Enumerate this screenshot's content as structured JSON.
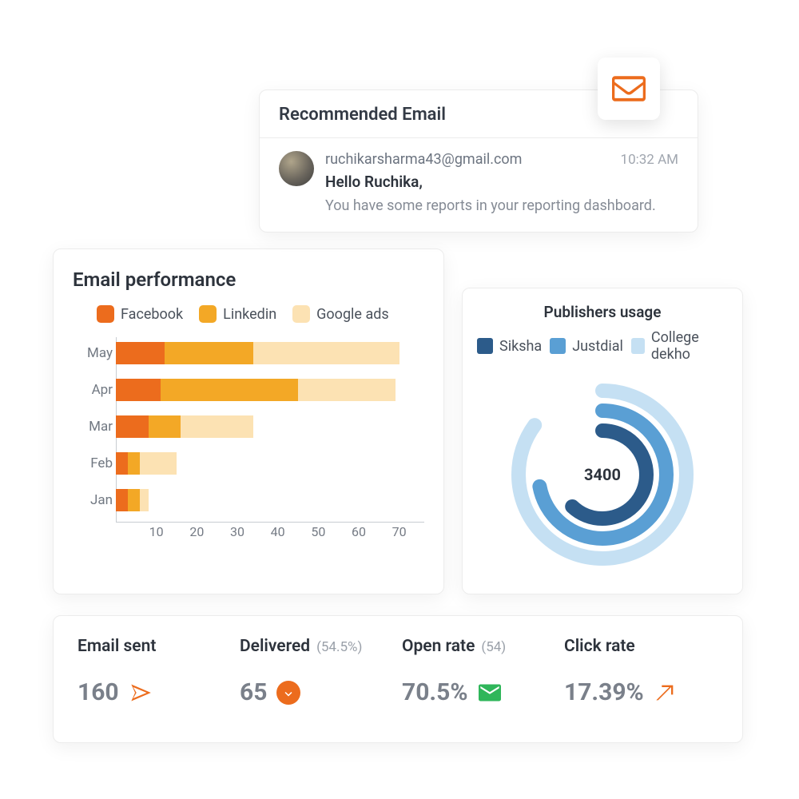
{
  "recommended_email": {
    "title": "Recommended Email",
    "address": "ruchikarsharma43@gmail.com",
    "time": "10:32 AM",
    "greeting": "Hello Ruchika,",
    "message": "You have some reports in your reporting dashboard."
  },
  "performance": {
    "title": "Email performance",
    "legend": {
      "fb": "Facebook",
      "li": "Linkedin",
      "ga": "Google ads"
    }
  },
  "publishers": {
    "title": "Publishers usage",
    "legend": {
      "s1": "Siksha",
      "s2": "Justdial",
      "s3": "College dekho"
    },
    "center": "3400"
  },
  "stats": {
    "sent": {
      "label": "Email sent",
      "value": "160"
    },
    "delivered": {
      "label": "Delivered",
      "sub": "(54.5%)",
      "value": "65"
    },
    "open": {
      "label": "Open rate",
      "sub": "(54)",
      "value": "70.5%"
    },
    "click": {
      "label": "Click rate",
      "value": "17.39%"
    }
  },
  "chart_data": [
    {
      "type": "bar",
      "orientation": "horizontal",
      "stacked": true,
      "title": "Email performance",
      "xlabel": "",
      "ylabel": "",
      "xlim": [
        0,
        75
      ],
      "x_ticks": [
        10,
        20,
        30,
        40,
        50,
        60,
        70
      ],
      "categories": [
        "May",
        "Apr",
        "Mar",
        "Feb",
        "Jan"
      ],
      "series": [
        {
          "name": "Facebook",
          "color": "#ec6c1d",
          "values": [
            12,
            11,
            8,
            3,
            3
          ]
        },
        {
          "name": "Linkedin",
          "color": "#f3a826",
          "values": [
            22,
            34,
            8,
            3,
            3
          ]
        },
        {
          "name": "Google ads",
          "color": "#fce2b3",
          "values": [
            36,
            24,
            18,
            9,
            2
          ]
        }
      ]
    },
    {
      "type": "radial",
      "title": "Publishers usage",
      "center_value": 3400,
      "series": [
        {
          "name": "Siksha",
          "color": "#2c5b8a",
          "fraction": 0.62
        },
        {
          "name": "Justdial",
          "color": "#5a9fd4",
          "fraction": 0.72
        },
        {
          "name": "College dekho",
          "color": "#c5e0f3",
          "fraction": 0.85
        }
      ]
    }
  ]
}
